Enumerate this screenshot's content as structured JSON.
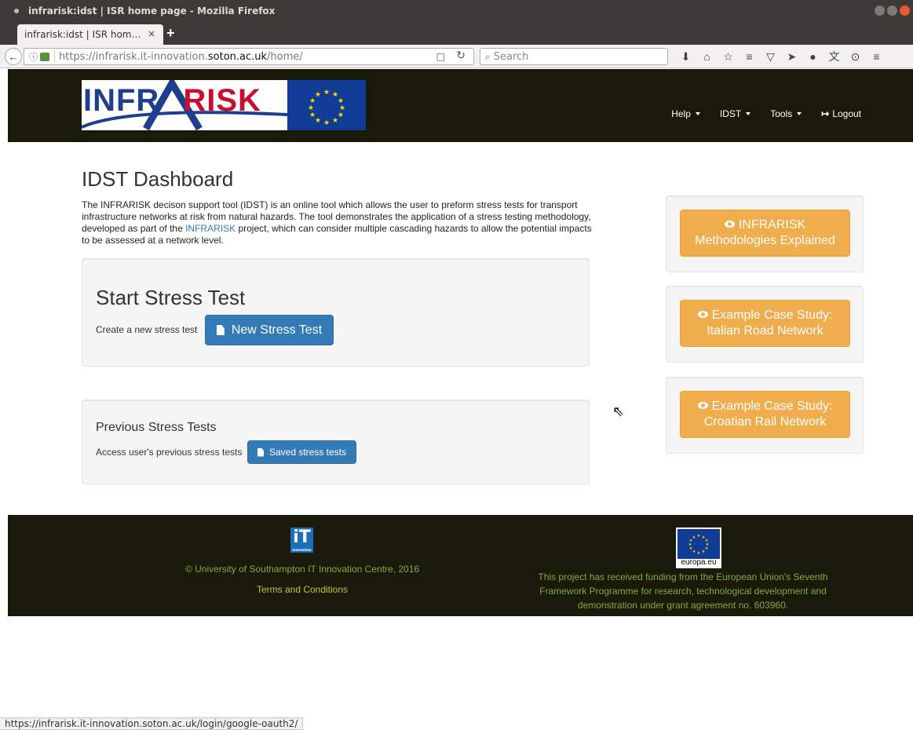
{
  "browser": {
    "window_title": "infrarisk:idst | ISR home page - Mozilla Firefox",
    "tab_title": "infrarisk:idst | ISR hom…",
    "tab_close": "×",
    "new_tab": "+",
    "url_prefix": "https://infrarisk.it-innovation.",
    "url_host": "soton.ac.uk",
    "url_suffix": "/home/",
    "search_placeholder": "Search",
    "status_url": "https://infrarisk.it-innovation.soton.ac.uk/login/google-oauth2/"
  },
  "header": {
    "logo_text_a": "INFR",
    "logo_text_b": "RISK",
    "nav": {
      "help": "Help",
      "idst": "IDST",
      "tools": "Tools",
      "logout": "Logout"
    }
  },
  "main": {
    "title": "IDST Dashboard",
    "intro_part1": "The INFRARISK decison support tool (IDST) is an online tool which allows the user to preform stress tests for transport infrastructure networks at risk from natural hazards. The tool demonstrates the application of a stress testing methodology, developed as part of the ",
    "intro_link": "INFRARISK",
    "intro_part2": " project, which can consider multiple cascading hazards to allow the potential impacts to be assessed at a network level.",
    "start": {
      "title": "Start Stress Test",
      "desc": "Create a new stress test",
      "button": "New Stress Test"
    },
    "previous": {
      "title": "Previous Stress Tests",
      "desc": "Access user's previous stress tests",
      "button": "Saved stress tests"
    }
  },
  "sidebar": {
    "items": [
      {
        "line1": "INFRARISK",
        "line2": "Methodologies Explained"
      },
      {
        "line1": "Example Case Study:",
        "line2": "Italian Road Network"
      },
      {
        "line1": "Example Case Study:",
        "line2": "Croatian Rail Network"
      }
    ]
  },
  "footer": {
    "it_logo": "iT",
    "it_logo_small": "innovation",
    "copyright": "© University of Southampton IT Innovation Centre, 2016",
    "terms": "Terms and Conditions",
    "eu_caption": "europa.eu",
    "funding_l1": "This project has received funding from the European Union's Seventh",
    "funding_l2": "Framework Programme for research, technological development and",
    "funding_l3": "demonstration under grant agreement no. 603960."
  },
  "colors": {
    "header_bg": "#1a1a0a",
    "primary": "#337ab7",
    "warning": "#f0ad4e",
    "footer_green": "#85a83d",
    "footer_yellow": "#c4c53a"
  }
}
